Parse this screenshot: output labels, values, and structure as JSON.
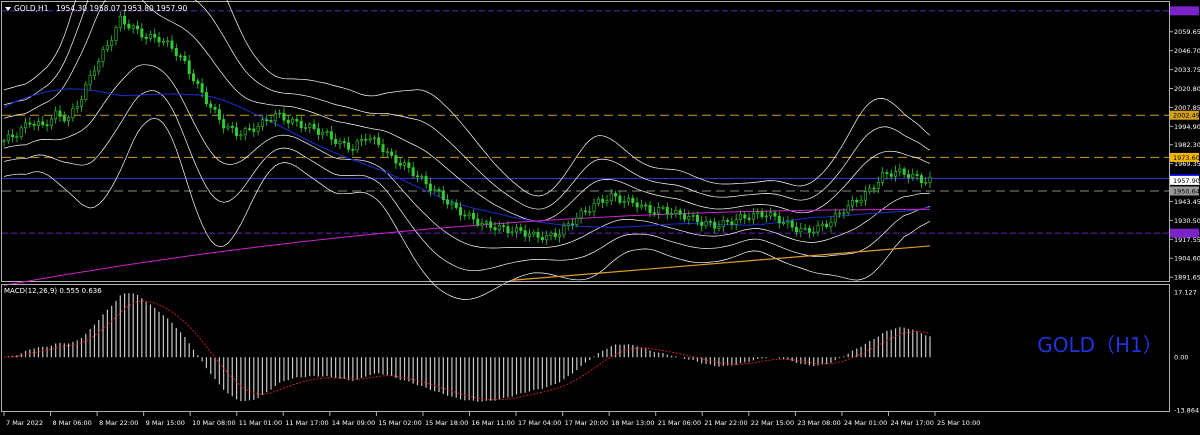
{
  "title": {
    "symbol": "GOLD,H1",
    "ohlc": "1954.30 1958.07 1953.80 1957.90",
    "menu_icon": "triangle-down-icon"
  },
  "watermark": "GOLD（H1）",
  "price_axis": {
    "ticks": [
      "2059.65",
      "2046.70",
      "2033.75",
      "2020.80",
      "2007.85",
      "1994.90",
      "1982.30",
      "1969.35",
      "1956.40",
      "1943.45",
      "1930.50",
      "1917.55",
      "1904.60",
      "1891.65"
    ],
    "tags": [
      {
        "label": "2073.95",
        "value": 2073.95,
        "color": "#7b22c9",
        "text_color": "#7b22c9"
      },
      {
        "label": "2002.49",
        "value": 2002.49,
        "color": "#d4a017",
        "text_color": "#000000"
      },
      {
        "label": "1973.60",
        "value": 1973.6,
        "color": "#f5b800",
        "text_color": "#000000"
      },
      {
        "label": "1959.25",
        "value": 1959.25,
        "color": "#0000cc",
        "text_color": "#ffffff"
      },
      {
        "label": "1957.90",
        "value": 1957.9,
        "color": "#ffffff",
        "text_color": "#000000"
      },
      {
        "label": "1950.64",
        "value": 1950.64,
        "color": "#999999",
        "text_color": "#000000"
      },
      {
        "label": "1921.79",
        "value": 1921.79,
        "color": "#7b22c9",
        "text_color": "#7b22c9"
      }
    ]
  },
  "levels": [
    {
      "value": 2073.95,
      "color": "#5a23b5",
      "dash": "6,3"
    },
    {
      "value": 2002.49,
      "color": "#c89a1a",
      "dash": "9,5"
    },
    {
      "value": 1973.6,
      "color": "#c89a1a",
      "dash": "9,5"
    },
    {
      "value": 1959.25,
      "color": "#3a3acc",
      "dash": ""
    },
    {
      "value": 1950.64,
      "color": "#8a8a8a",
      "dash": "9,5"
    },
    {
      "value": 1921.79,
      "color": "#5a23b5",
      "dash": "6,3"
    }
  ],
  "macd": {
    "label": "MACD(12,26,9) 0.555 0.636",
    "ticks": [
      "17.127",
      "0.00",
      "-13.864"
    ]
  },
  "time_axis": [
    "7 Mar 2022",
    "8 Mar 06:00",
    "8 Mar 22:00",
    "9 Mar 15:00",
    "10 Mar 08:00",
    "11 Mar 01:00",
    "11 Mar 17:00",
    "14 Mar 09:00",
    "15 Mar 02:00",
    "15 Mar 18:00",
    "16 Mar 11:00",
    "17 Mar 04:00",
    "17 Mar 20:00",
    "18 Mar 13:00",
    "21 Mar 06:00",
    "21 Mar 22:00",
    "22 Mar 15:00",
    "23 Mar 08:00",
    "24 Mar 01:00",
    "24 Mar 17:00",
    "25 Mar 10:00"
  ],
  "chart_data": {
    "type": "line",
    "series": [
      {
        "name": "GOLD,H1",
        "values": [
          1985,
          1990,
          1998,
          1995,
          2003,
          2000,
          2015,
          2035,
          2050,
          2068,
          2062,
          2056,
          2055,
          2049,
          2038,
          2022,
          2008,
          1996,
          1990,
          1992,
          1997,
          2003,
          1999,
          1996,
          1993,
          1989,
          1983,
          1980,
          1988,
          1983,
          1973,
          1968,
          1961,
          1953,
          1946,
          1938,
          1933,
          1928,
          1926,
          1924,
          1923,
          1920,
          1919,
          1922,
          1930,
          1937,
          1943,
          1947,
          1944,
          1942,
          1937,
          1938,
          1935,
          1933,
          1929,
          1927,
          1929,
          1932,
          1934,
          1935,
          1931,
          1926,
          1923,
          1925,
          1930,
          1938,
          1944,
          1951,
          1961,
          1964,
          1962,
          1958
        ]
      }
    ]
  },
  "colors": {
    "candle_up": "#33cc33",
    "bands": "#ffffff",
    "ma_blue": "#1a2fd0",
    "ma_magenta": "#cc22cc",
    "trendline": "#e09a2a",
    "macd_hist": "#c8c8c8",
    "macd_signal": "#e02020",
    "frame": "#b0b0b0",
    "watermark": "#2233dd"
  }
}
